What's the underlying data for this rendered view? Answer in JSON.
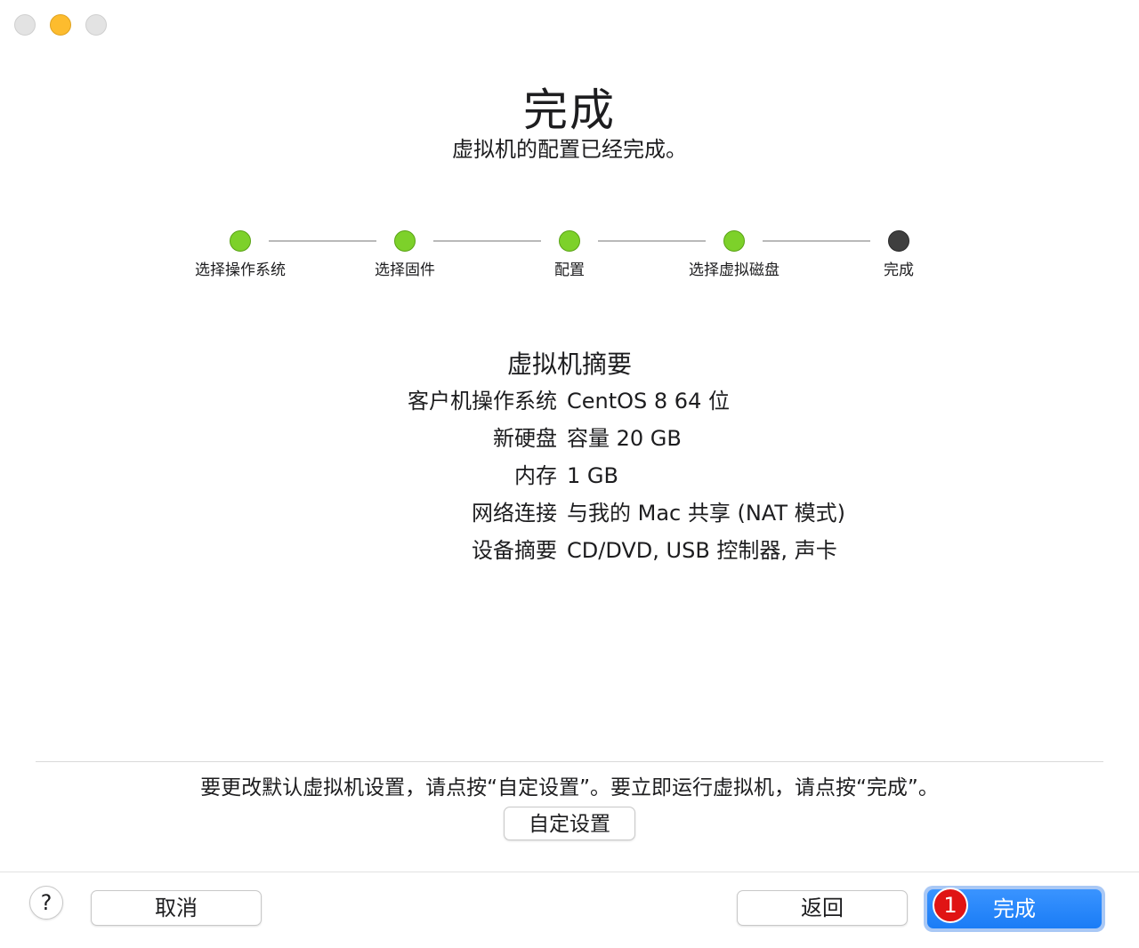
{
  "title": "完成",
  "subtitle": "虚拟机的配置已经完成。",
  "steps": [
    {
      "label": "选择操作系统",
      "status": "done"
    },
    {
      "label": "选择固件",
      "status": "done"
    },
    {
      "label": "配置",
      "status": "done"
    },
    {
      "label": "选择虚拟磁盘",
      "status": "done"
    },
    {
      "label": "完成",
      "status": "current"
    }
  ],
  "summary": {
    "title": "虚拟机摘要",
    "rows": [
      {
        "key": "客户机操作系统",
        "value": "CentOS 8 64 位"
      },
      {
        "key": "新硬盘",
        "value": "容量 20 GB"
      },
      {
        "key": "内存",
        "value": "1 GB"
      },
      {
        "key": "网络连接",
        "value": "与我的 Mac 共享 (NAT 模式)"
      },
      {
        "key": "设备摘要",
        "value": "CD/DVD, USB 控制器, 声卡"
      }
    ]
  },
  "hint": "要更改默认虚拟机设置，请点按“自定设置”。要立即运行虚拟机，请点按“完成”。",
  "buttons": {
    "customize": "自定设置",
    "help": "?",
    "cancel": "取消",
    "back": "返回",
    "finish": "完成"
  },
  "badge": "1",
  "colors": {
    "step_done": "#7dd12a",
    "step_current": "#3f3f3f",
    "primary": "#1a7cf6",
    "badge": "#e01414"
  }
}
